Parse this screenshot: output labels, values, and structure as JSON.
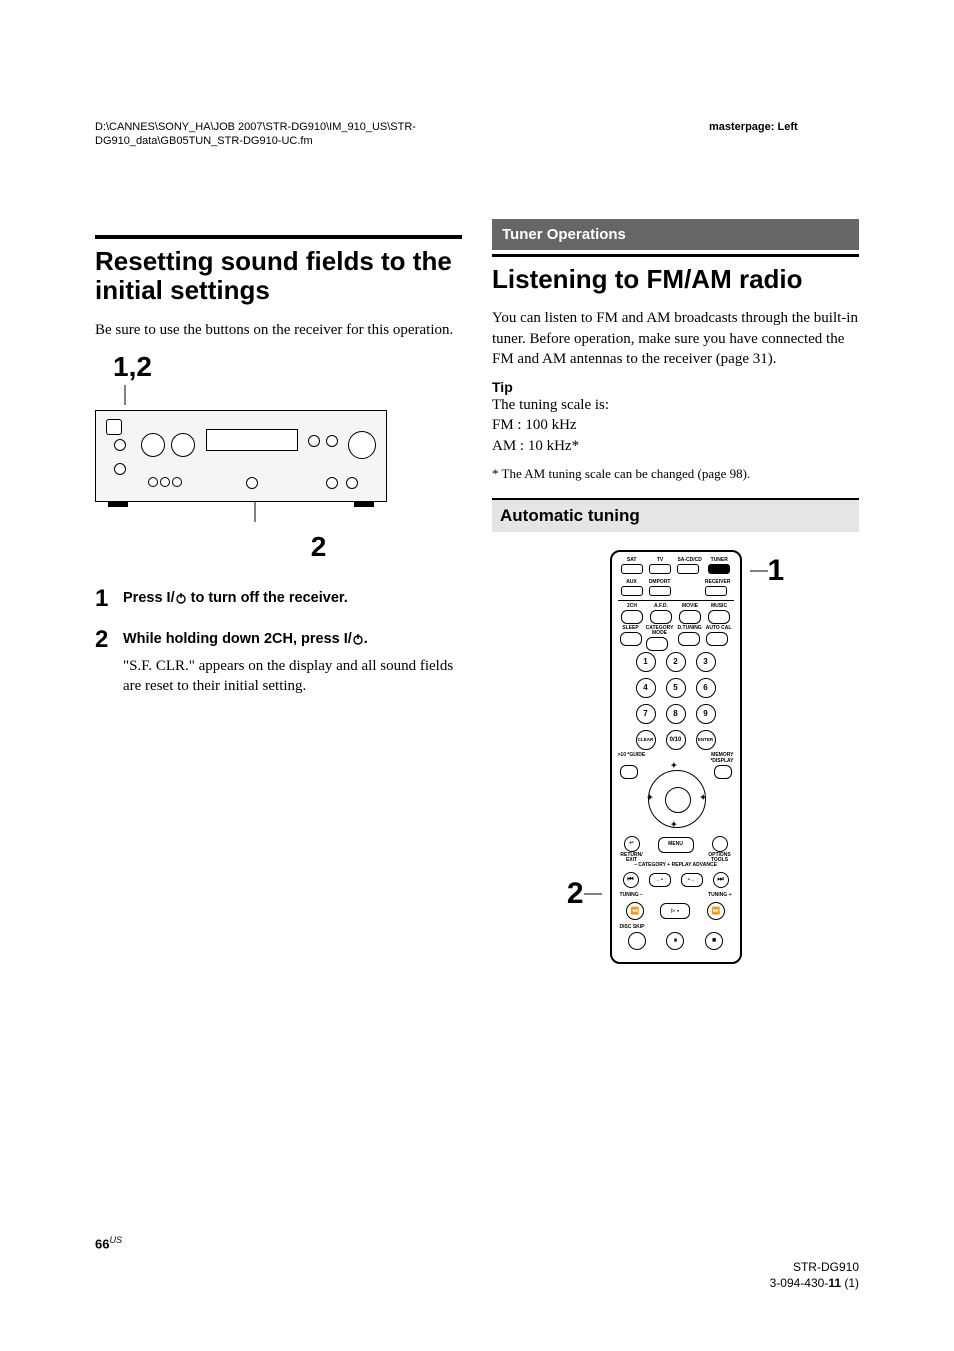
{
  "header": {
    "path": "D:\\CANNES\\SONY_HA\\JOB 2007\\STR-DG910\\IM_910_US\\STR-DG910_data\\GB05TUN_STR-DG910-UC.fm",
    "master_label": "masterpage:",
    "master_value": "Left"
  },
  "left": {
    "title": "Resetting sound fields to the initial settings",
    "intro": "Be sure to use the buttons on the receiver for this operation.",
    "diagram": {
      "top_label": "1,2",
      "bottom_label": "2"
    },
    "steps": [
      {
        "num": "1",
        "title_pre": "Press ",
        "title_mid": " to turn off the receiver.",
        "title_io": "I/",
        "desc": ""
      },
      {
        "num": "2",
        "title_pre": "While holding down 2CH, press ",
        "title_mid": ".",
        "title_io": "I/",
        "desc": "\"S.F. CLR.\" appears on the display and all sound fields are reset to their initial setting."
      }
    ]
  },
  "right": {
    "section": "Tuner Operations",
    "title": "Listening to FM/AM radio",
    "para": "You can listen to FM and AM broadcasts through the built-in tuner. Before operation, make sure you have connected the FM and AM antennas to the receiver (page 31).",
    "tip_head": "Tip",
    "tip_body1": "The tuning scale is:",
    "tip_body2": "FM : 100 kHz",
    "tip_body3": "AM : 10 kHz*",
    "footnote": "* The AM tuning scale can be changed (page 98).",
    "sub": "Automatic tuning",
    "callout1": "1",
    "callout2": "2",
    "remote": {
      "row1": [
        "SAT",
        "TV",
        "SA-CD/CD",
        "TUNER"
      ],
      "row2": [
        "AUX",
        "DMPORT",
        "",
        "RECEIVER"
      ],
      "row3": [
        "2CH",
        "A.F.D.",
        "MOVIE",
        "MUSIC"
      ],
      "row4": [
        "SLEEP",
        "CATEGORY MODE",
        "D.TUNING",
        "AUTO CAL"
      ],
      "numpad": [
        [
          "1",
          "2",
          "3"
        ],
        [
          "4",
          "5",
          "6"
        ],
        [
          "7",
          "8",
          "9"
        ],
        [
          "CLEAR",
          "0/10",
          "ENTER"
        ]
      ],
      "guide": ">10 *GUIDE",
      "memory": "MEMORY *DISPLAY",
      "menu_row": [
        "RETURN/ EXIT",
        "MENU",
        "OPTIONS TOOLS"
      ],
      "cat": "– CATEGORY + REPLAY ADVANCE",
      "tuning": [
        "TUNING –",
        "TUNING +"
      ],
      "disc": "DISC SKIP"
    }
  },
  "footer": {
    "page_num": "66",
    "page_region": "US",
    "model": "STR-DG910",
    "doc": "3-094-430-",
    "doc_bold": "11",
    "doc_rev": " (1)"
  }
}
